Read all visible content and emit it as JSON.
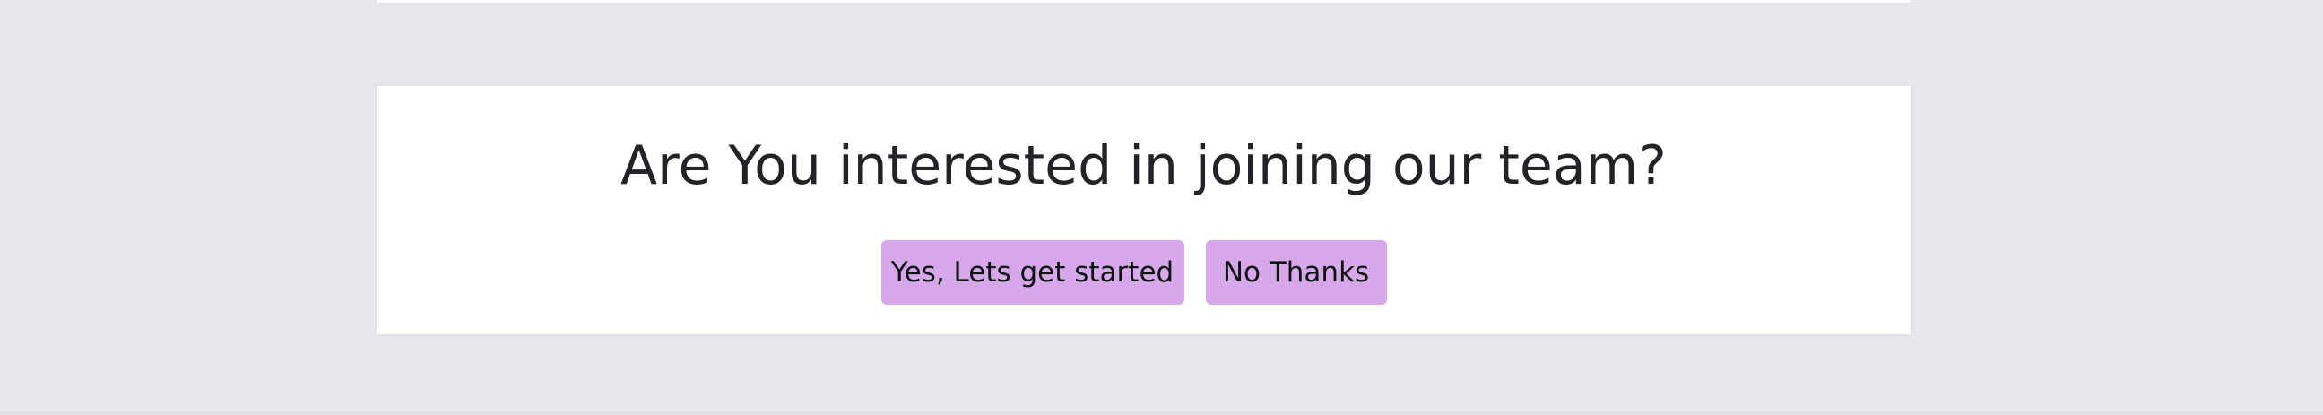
{
  "cta": {
    "title": "Are You interested in joining our team?",
    "yes_label": "Yes, Lets get started",
    "no_label": "No Thanks"
  },
  "colors": {
    "page_background": "#e9e7ec",
    "card_background": "#ffffff",
    "button_background": "#d6a8ea",
    "title_text": "#222326"
  }
}
